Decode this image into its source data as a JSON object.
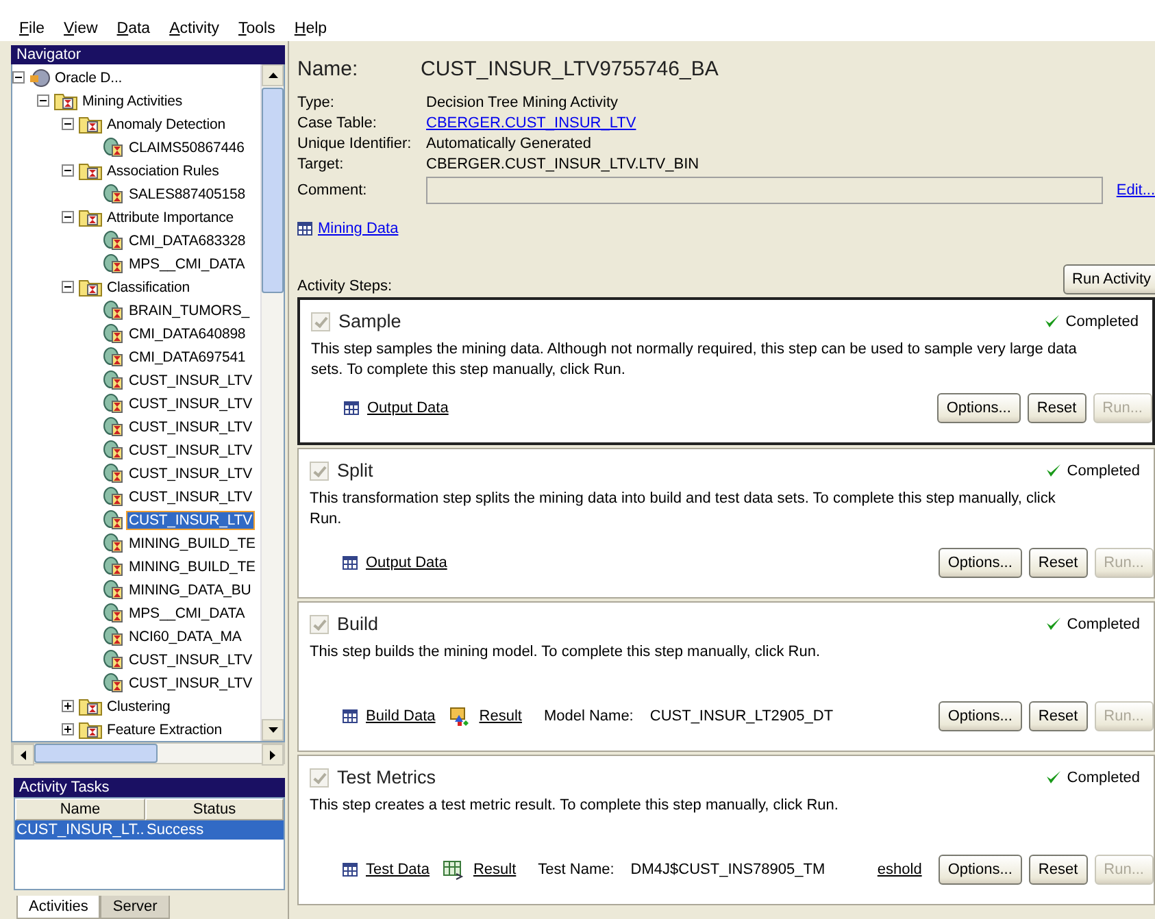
{
  "menu": [
    {
      "label": "File"
    },
    {
      "label": "View"
    },
    {
      "label": "Data"
    },
    {
      "label": "Activity"
    },
    {
      "label": "Tools"
    },
    {
      "label": "Help"
    }
  ],
  "navigator": {
    "title": "Navigator",
    "tree": [
      {
        "label": "Oracle D...",
        "kind": "server",
        "expanded": true,
        "selected": false,
        "children": [
          {
            "label": "Mining Activities",
            "kind": "folder",
            "expanded": true,
            "selected": false,
            "children": [
              {
                "label": "Anomaly Detection",
                "kind": "folder",
                "expanded": true,
                "selected": false,
                "children": [
                  {
                    "label": "CLAIMS50867446",
                    "kind": "activity",
                    "selected": false
                  }
                ]
              },
              {
                "label": "Association Rules",
                "kind": "folder",
                "expanded": true,
                "selected": false,
                "children": [
                  {
                    "label": "SALES887405158",
                    "kind": "activity",
                    "selected": false
                  }
                ]
              },
              {
                "label": "Attribute Importance",
                "kind": "folder",
                "expanded": true,
                "selected": false,
                "children": [
                  {
                    "label": "CMI_DATA683328",
                    "kind": "activity",
                    "selected": false
                  },
                  {
                    "label": "MPS__CMI_DATA",
                    "kind": "activity",
                    "selected": false
                  }
                ]
              },
              {
                "label": "Classification",
                "kind": "folder",
                "expanded": true,
                "selected": false,
                "children": [
                  {
                    "label": "BRAIN_TUMORS_",
                    "kind": "activity",
                    "selected": false
                  },
                  {
                    "label": "CMI_DATA640898",
                    "kind": "activity",
                    "selected": false
                  },
                  {
                    "label": "CMI_DATA697541",
                    "kind": "activity",
                    "selected": false
                  },
                  {
                    "label": "CUST_INSUR_LTV",
                    "kind": "activity",
                    "selected": false
                  },
                  {
                    "label": "CUST_INSUR_LTV",
                    "kind": "activity",
                    "selected": false
                  },
                  {
                    "label": "CUST_INSUR_LTV",
                    "kind": "activity",
                    "selected": false
                  },
                  {
                    "label": "CUST_INSUR_LTV",
                    "kind": "activity",
                    "selected": false
                  },
                  {
                    "label": "CUST_INSUR_LTV",
                    "kind": "activity",
                    "selected": false
                  },
                  {
                    "label": "CUST_INSUR_LTV",
                    "kind": "activity",
                    "selected": false
                  },
                  {
                    "label": "CUST_INSUR_LTV",
                    "kind": "activity",
                    "selected": true
                  },
                  {
                    "label": "MINING_BUILD_TE",
                    "kind": "activity",
                    "selected": false
                  },
                  {
                    "label": "MINING_BUILD_TE",
                    "kind": "activity",
                    "selected": false
                  },
                  {
                    "label": "MINING_DATA_BU",
                    "kind": "activity",
                    "selected": false
                  },
                  {
                    "label": "MPS__CMI_DATA",
                    "kind": "activity",
                    "selected": false
                  },
                  {
                    "label": "NCI60_DATA_MA",
                    "kind": "activity",
                    "selected": false
                  },
                  {
                    "label": "CUST_INSUR_LTV",
                    "kind": "activity",
                    "selected": false
                  },
                  {
                    "label": "CUST_INSUR_LTV",
                    "kind": "activity",
                    "selected": false
                  }
                ]
              },
              {
                "label": "Clustering",
                "kind": "folder",
                "expanded": false,
                "selected": false
              },
              {
                "label": "Feature Extraction",
                "kind": "folder",
                "expanded": false,
                "selected": false
              }
            ]
          }
        ]
      }
    ]
  },
  "activity_tasks": {
    "title": "Activity Tasks",
    "columns": [
      "Name",
      "Status"
    ],
    "rows": [
      {
        "name": "CUST_INSUR_LT...",
        "status": "Success",
        "selected": true
      }
    ]
  },
  "bottom_tabs": [
    {
      "label": "Activities",
      "selected": true
    },
    {
      "label": "Server",
      "selected": false
    }
  ],
  "details": {
    "name_label": "Name:",
    "name": "CUST_INSUR_LTV9755746_BA",
    "fields": [
      {
        "label": "Type:",
        "kind": "text",
        "value": "Decision Tree Mining Activity"
      },
      {
        "label": "Case Table:",
        "kind": "link",
        "value": "CBERGER.CUST_INSUR_LTV"
      },
      {
        "label": "Unique Identifier:",
        "kind": "text",
        "value": "Automatically Generated"
      },
      {
        "label": "Target:",
        "kind": "text",
        "value": "CBERGER.CUST_INSUR_LTV.LTV_BIN"
      },
      {
        "label": "Comment:",
        "kind": "input"
      }
    ],
    "edit_link": "Edit...",
    "mining_data": "Mining Data",
    "steps_label": "Activity Steps:",
    "run_button": "Run Activity"
  },
  "steps": [
    {
      "title": "Sample",
      "checked": true,
      "focused": true,
      "status": "Completed",
      "description": "This step samples the mining data. Although not normally required, this step can be used to sample very large data sets. To complete this step manually, click Run.",
      "links": [
        {
          "kind": "data",
          "label": "Output Data"
        }
      ],
      "buttons": [
        {
          "label": "Options...",
          "disabled": false
        },
        {
          "label": "Reset",
          "disabled": false
        },
        {
          "label": "Run...",
          "disabled": true
        }
      ]
    },
    {
      "title": "Split",
      "checked": true,
      "focused": false,
      "status": "Completed",
      "description": "This transformation step splits the mining data into build and test data sets. To complete this step manually, click Run.",
      "links": [
        {
          "kind": "data",
          "label": "Output Data"
        }
      ],
      "buttons": [
        {
          "label": "Options...",
          "disabled": false
        },
        {
          "label": "Reset",
          "disabled": false
        },
        {
          "label": "Run...",
          "disabled": true
        }
      ]
    },
    {
      "title": "Build",
      "checked": true,
      "focused": false,
      "status": "Completed",
      "description": "This step builds the mining model. To complete this step manually, click Run.",
      "links": [
        {
          "kind": "data",
          "label": "Build Data"
        },
        {
          "kind": "model",
          "label": "Result"
        }
      ],
      "info_label": "Model Name:",
      "info_value": "CUST_INSUR_LT2905_DT",
      "buttons": [
        {
          "label": "Options...",
          "disabled": false
        },
        {
          "label": "Reset",
          "disabled": false
        },
        {
          "label": "Run...",
          "disabled": true
        }
      ]
    },
    {
      "title": "Test Metrics",
      "checked": true,
      "focused": false,
      "status": "Completed",
      "description": "This step creates a test metric result. To complete this step manually, click Run.",
      "links": [
        {
          "kind": "data",
          "label": "Test Data"
        },
        {
          "kind": "metrics",
          "label": "Result"
        }
      ],
      "info_label": "Test Name:",
      "info_value": "DM4J$CUST_INS78905_TM",
      "trailing_link": "eshold",
      "buttons": [
        {
          "label": "Options...",
          "disabled": false
        },
        {
          "label": "Reset",
          "disabled": false
        },
        {
          "label": "Run...",
          "disabled": true
        }
      ]
    }
  ]
}
